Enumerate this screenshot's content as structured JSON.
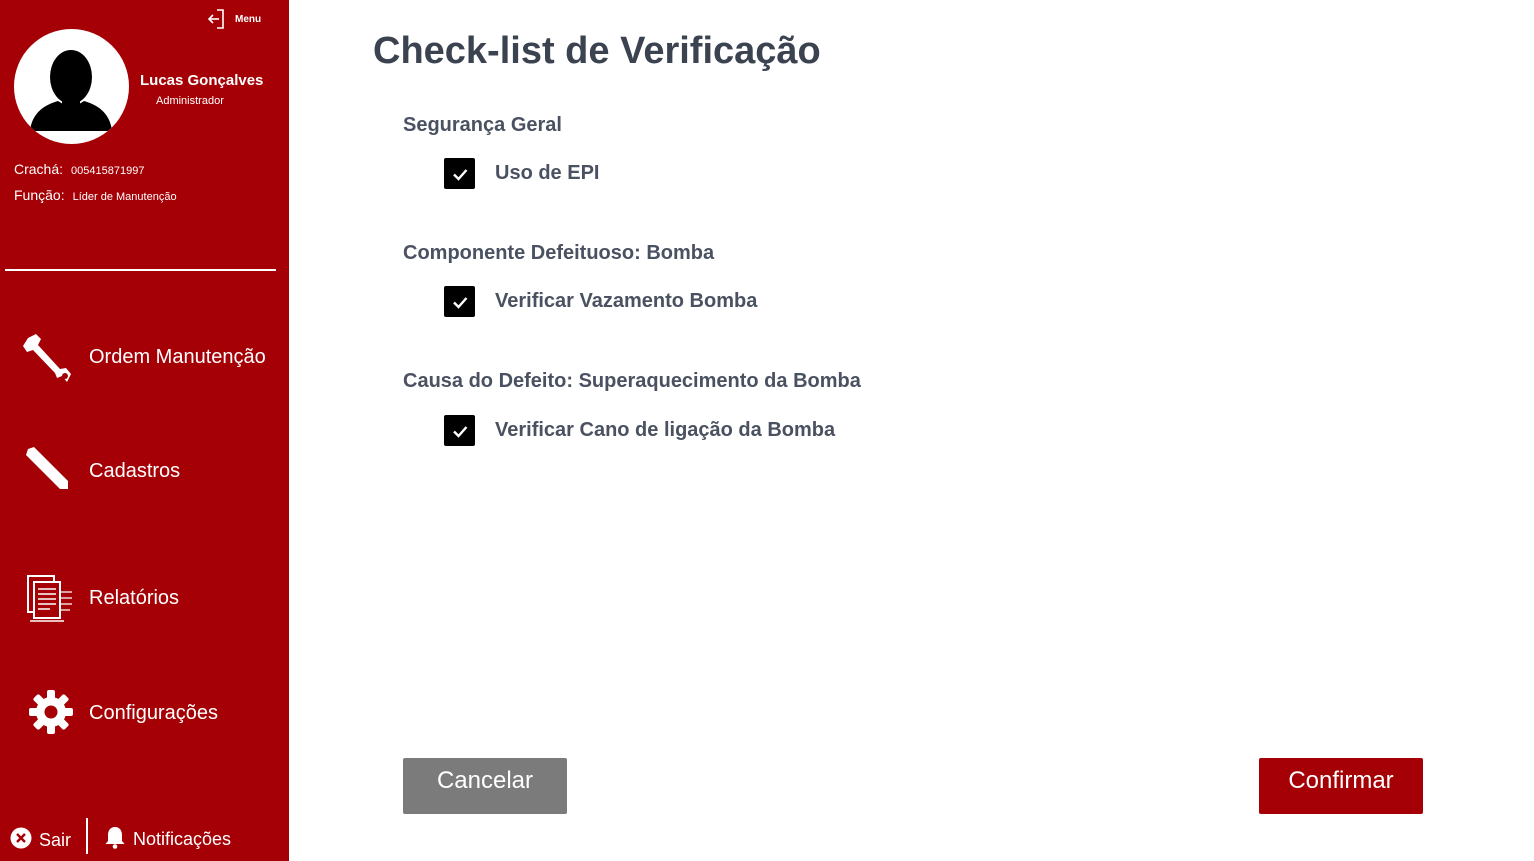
{
  "sidebar": {
    "menu_label": "Menu",
    "user": {
      "name": "Lucas Gonçalves",
      "role": "Administrador",
      "badge_label": "Crachá:",
      "badge_value": "005415871997",
      "function_label": "Função:",
      "function_value": "Líder de Manutenção"
    },
    "nav": [
      {
        "label": "Ordem Manutenção",
        "icon": "wrench-icon"
      },
      {
        "label": "Cadastros",
        "icon": "pencil-icon"
      },
      {
        "label": "Relatórios",
        "icon": "reports-icon"
      },
      {
        "label": "Configurações",
        "icon": "gear-icon"
      }
    ],
    "footer": {
      "logout_label": "Sair",
      "notifications_label": "Notificações"
    }
  },
  "main": {
    "title": "Check-list de Verificação",
    "sections": [
      {
        "title": "Segurança Geral",
        "items": [
          {
            "label": "Uso de EPI",
            "checked": true
          }
        ]
      },
      {
        "title": "Componente Defeituoso: Bomba",
        "items": [
          {
            "label": "Verificar Vazamento Bomba",
            "checked": true
          }
        ]
      },
      {
        "title": "Causa do Defeito: Superaquecimento da Bomba",
        "items": [
          {
            "label": "Verificar Cano de ligação da Bomba",
            "checked": true
          }
        ]
      }
    ],
    "actions": {
      "cancel_label": "Cancelar",
      "confirm_label": "Confirmar"
    }
  },
  "colors": {
    "sidebar_bg": "#a50005",
    "confirm_bg": "#a50005",
    "cancel_bg": "#7b7b7b",
    "text_dark": "#3b4350"
  }
}
